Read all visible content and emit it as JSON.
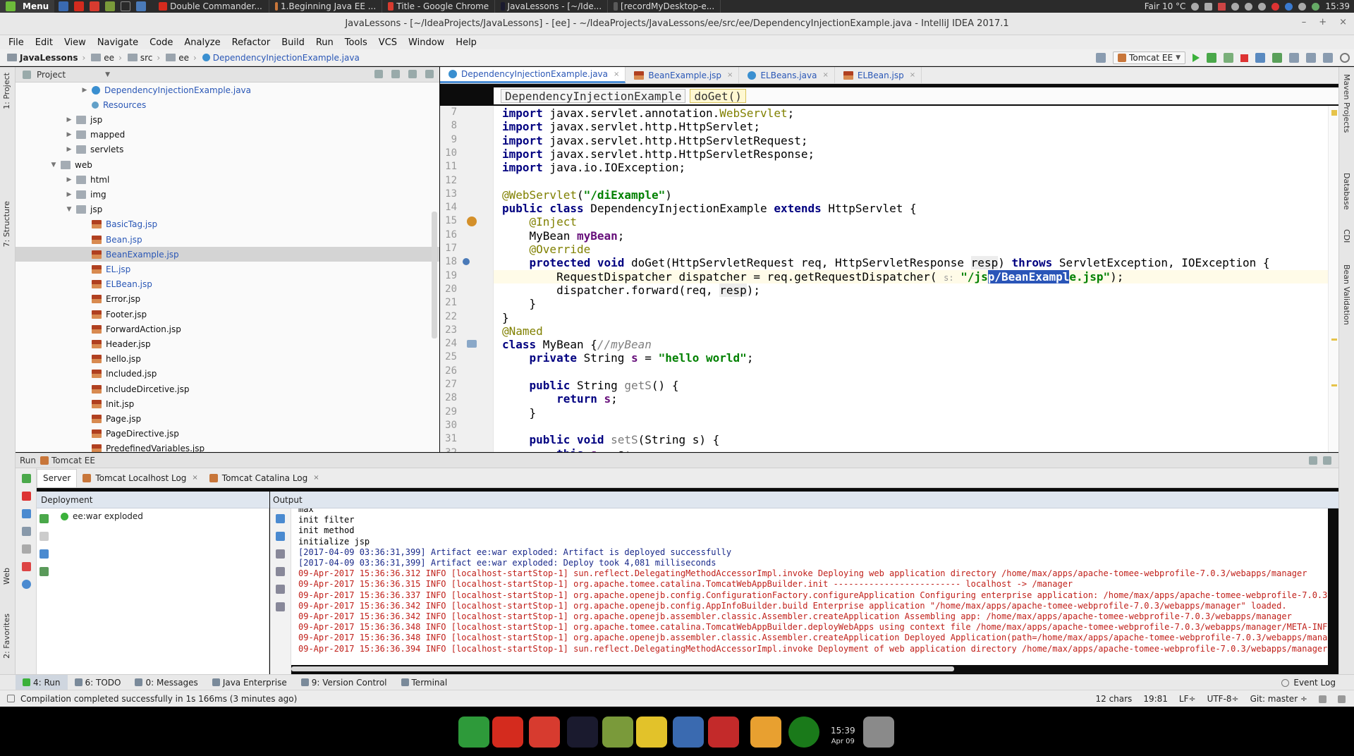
{
  "os_panel": {
    "menu_label": "Menu",
    "tasks": [
      "Double Commander...",
      "1.Beginning Java EE ...",
      "Title - Google Chrome",
      "JavaLessons - [~/Ide...",
      "[recordMyDesktop-e..."
    ],
    "weather": "Fair 10 °C",
    "clock": "15:39"
  },
  "window": {
    "title": "JavaLessons - [~/IdeaProjects/JavaLessons] - [ee] - ~/IdeaProjects/JavaLessons/ee/src/ee/DependencyInjectionExample.java - IntelliJ IDEA 2017.1"
  },
  "menubar": [
    "File",
    "Edit",
    "View",
    "Navigate",
    "Code",
    "Analyze",
    "Refactor",
    "Build",
    "Run",
    "Tools",
    "VCS",
    "Window",
    "Help"
  ],
  "navbar": {
    "crumbs": [
      "JavaLessons",
      "ee",
      "src",
      "ee",
      "DependencyInjectionExample.java"
    ],
    "run_config": "Tomcat EE"
  },
  "left_stripe": [
    "1: Project",
    "7: Structure",
    "Web",
    "2: Favorites"
  ],
  "right_stripe": [
    "Maven Projects",
    "Database",
    "CDI",
    "Bean Validation"
  ],
  "project": {
    "header": "Project",
    "tree": [
      {
        "label": "DependencyInjectionExample.java",
        "type": "java",
        "indent": 3,
        "arrow": "▶",
        "blue": true
      },
      {
        "label": "Resources",
        "type": "res",
        "indent": 3,
        "arrow": "",
        "blue": true
      },
      {
        "label": "jsp",
        "type": "folder",
        "indent": 2,
        "arrow": "▶",
        "blue": false
      },
      {
        "label": "mapped",
        "type": "folder",
        "indent": 2,
        "arrow": "▶",
        "blue": false
      },
      {
        "label": "servlets",
        "type": "folder",
        "indent": 2,
        "arrow": "▶",
        "blue": false
      },
      {
        "label": "web",
        "type": "folder",
        "indent": 1,
        "arrow": "▼",
        "blue": false
      },
      {
        "label": "html",
        "type": "folder",
        "indent": 2,
        "arrow": "▶",
        "blue": false
      },
      {
        "label": "img",
        "type": "folder",
        "indent": 2,
        "arrow": "▶",
        "blue": false
      },
      {
        "label": "jsp",
        "type": "folder",
        "indent": 2,
        "arrow": "▼",
        "blue": false
      },
      {
        "label": "BasicTag.jsp",
        "type": "jsp",
        "indent": 3,
        "arrow": "",
        "blue": true
      },
      {
        "label": "Bean.jsp",
        "type": "jsp",
        "indent": 3,
        "arrow": "",
        "blue": true
      },
      {
        "label": "BeanExample.jsp",
        "type": "jsp",
        "indent": 3,
        "arrow": "",
        "blue": true,
        "selected": true
      },
      {
        "label": "EL.jsp",
        "type": "jsp",
        "indent": 3,
        "arrow": "",
        "blue": true
      },
      {
        "label": "ELBean.jsp",
        "type": "jsp",
        "indent": 3,
        "arrow": "",
        "blue": true
      },
      {
        "label": "Error.jsp",
        "type": "jsp",
        "indent": 3,
        "arrow": "",
        "blue": false
      },
      {
        "label": "Footer.jsp",
        "type": "jsp",
        "indent": 3,
        "arrow": "",
        "blue": false
      },
      {
        "label": "ForwardAction.jsp",
        "type": "jsp",
        "indent": 3,
        "arrow": "",
        "blue": false
      },
      {
        "label": "Header.jsp",
        "type": "jsp",
        "indent": 3,
        "arrow": "",
        "blue": false
      },
      {
        "label": "hello.jsp",
        "type": "jsp",
        "indent": 3,
        "arrow": "",
        "blue": false
      },
      {
        "label": "Included.jsp",
        "type": "jsp",
        "indent": 3,
        "arrow": "",
        "blue": false
      },
      {
        "label": "IncludeDircetive.jsp",
        "type": "jsp",
        "indent": 3,
        "arrow": "",
        "blue": false
      },
      {
        "label": "Init.jsp",
        "type": "jsp",
        "indent": 3,
        "arrow": "",
        "blue": false
      },
      {
        "label": "Page.jsp",
        "type": "jsp",
        "indent": 3,
        "arrow": "",
        "blue": false
      },
      {
        "label": "PageDirective.jsp",
        "type": "jsp",
        "indent": 3,
        "arrow": "",
        "blue": false
      },
      {
        "label": "PredefinedVariables.jsp",
        "type": "jsp",
        "indent": 3,
        "arrow": "",
        "blue": false
      }
    ]
  },
  "editor": {
    "tabs": [
      {
        "label": "DependencyInjectionExample.java",
        "active": true,
        "icon": "java-class-icon"
      },
      {
        "label": "BeanExample.jsp",
        "active": false,
        "icon": "jsp-file-icon"
      },
      {
        "label": "ELBeans.java",
        "active": false,
        "icon": "java-class-icon"
      },
      {
        "label": "ELBean.jsp",
        "active": false,
        "icon": "jsp-file-icon"
      }
    ],
    "breadcrumb_class": "DependencyInjectionExample",
    "breadcrumb_method": "doGet()",
    "param_hint": "s:",
    "lines": [
      {
        "n": "7",
        "html": "<span class='kw'>import</span> javax.servlet.annotation.<span class='an'>WebServlet</span>;"
      },
      {
        "n": "8",
        "html": "<span class='kw'>import</span> javax.servlet.http.HttpServlet;"
      },
      {
        "n": "9",
        "html": "<span class='kw'>import</span> javax.servlet.http.HttpServletRequest;"
      },
      {
        "n": "10",
        "html": "<span class='kw'>import</span> javax.servlet.http.HttpServletResponse;"
      },
      {
        "n": "11",
        "html": "<span class='kw'>import</span> java.io.IOException;"
      },
      {
        "n": "12",
        "html": ""
      },
      {
        "n": "13",
        "html": "<span class='an'>@WebServlet</span>(<span class='st'>\"/diExample\"</span>)"
      },
      {
        "n": "14",
        "html": "<span class='kw'>public class</span> DependencyInjectionExample <span class='kw'>extends</span> HttpServlet {"
      },
      {
        "n": "15",
        "html": "    <span class='an'>@Inject</span>"
      },
      {
        "n": "16",
        "html": "    MyBean <span class='fld'>myBean</span>;"
      },
      {
        "n": "17",
        "html": "    <span class='an'>@Override</span>"
      },
      {
        "n": "18",
        "html": "    <span class='kw'>protected void</span> doGet(HttpServletRequest req, HttpServletResponse <span class='param'>resp</span>) <span class='kw'>throws</span> ServletException, IOException {"
      },
      {
        "n": "19",
        "html": "        RequestDispatcher dispatcher = req.getRequestDispatcher( <span class='hint'>s:</span> <span class='st'>\"/js<span class='sel2'>p/BeanExampl</span>e.jsp\"</span>);"
      },
      {
        "n": "20",
        "html": "        dispatcher.forward(req, <span class='param'>resp</span>);"
      },
      {
        "n": "21",
        "html": "    }"
      },
      {
        "n": "22",
        "html": "}"
      },
      {
        "n": "23",
        "html": "<span class='an'>@Named</span>"
      },
      {
        "n": "24",
        "html": "<span class='kw'>class</span> MyBean {<span class='cm'>//myBean</span>"
      },
      {
        "n": "25",
        "html": "    <span class='kw'>private</span> String <span class='fld'>s</span> = <span class='st'>\"hello world\"</span>;"
      },
      {
        "n": "26",
        "html": ""
      },
      {
        "n": "27",
        "html": "    <span class='kw'>public</span> String <span class='mt'>getS</span>() {"
      },
      {
        "n": "28",
        "html": "        <span class='kw'>return</span> <span class='fld'>s</span>;"
      },
      {
        "n": "29",
        "html": "    }"
      },
      {
        "n": "30",
        "html": ""
      },
      {
        "n": "31",
        "html": "    <span class='kw'>public void</span> <span class='mt'>setS</span>(String s) {"
      },
      {
        "n": "32",
        "html": "        <span class='kw'>this</span>.<span class='fld'>s</span> = s;"
      }
    ]
  },
  "run": {
    "header": "Run",
    "config": "Tomcat EE",
    "tabs": [
      {
        "label": "Server",
        "active": true,
        "close": false
      },
      {
        "label": "Tomcat Localhost Log",
        "active": false,
        "close": true
      },
      {
        "label": "Tomcat Catalina Log",
        "active": false,
        "close": true
      }
    ],
    "deployment_header": "Deployment",
    "deployment_item": "ee:war exploded",
    "output_header": "Output",
    "output_lines": [
      {
        "text": "max",
        "kind": "sys"
      },
      {
        "text": "init filter",
        "kind": "sys"
      },
      {
        "text": "init method",
        "kind": "sys"
      },
      {
        "text": "initialize jsp",
        "kind": "sys"
      },
      {
        "text": "[2017-04-09 03:36:31,399] Artifact ee:war exploded: Artifact is deployed successfully",
        "kind": "art"
      },
      {
        "text": "[2017-04-09 03:36:31,399] Artifact ee:war exploded: Deploy took 4,081 milliseconds",
        "kind": "art"
      },
      {
        "text": "09-Apr-2017 15:36:36.312 INFO [localhost-startStop-1] sun.reflect.DelegatingMethodAccessorImpl.invoke Deploying web application directory /home/max/apps/apache-tomee-webprofile-7.0.3/webapps/manager",
        "kind": "err"
      },
      {
        "text": "09-Apr-2017 15:36:36.315 INFO [localhost-startStop-1] org.apache.tomee.catalina.TomcatWebAppBuilder.init ------------------------- localhost -> /manager",
        "kind": "err"
      },
      {
        "text": "09-Apr-2017 15:36:36.337 INFO [localhost-startStop-1] org.apache.openejb.config.ConfigurationFactory.configureApplication Configuring enterprise application: /home/max/apps/apache-tomee-webprofile-7.0.3/webapps/",
        "kind": "err"
      },
      {
        "text": "09-Apr-2017 15:36:36.342 INFO [localhost-startStop-1] org.apache.openejb.config.AppInfoBuilder.build Enterprise application \"/home/max/apps/apache-tomee-webprofile-7.0.3/webapps/manager\" loaded.",
        "kind": "err"
      },
      {
        "text": "09-Apr-2017 15:36:36.342 INFO [localhost-startStop-1] org.apache.openejb.assembler.classic.Assembler.createApplication Assembling app: /home/max/apps/apache-tomee-webprofile-7.0.3/webapps/manager",
        "kind": "err"
      },
      {
        "text": "09-Apr-2017 15:36:36.348 INFO [localhost-startStop-1] org.apache.tomee.catalina.TomcatWebAppBuilder.deployWebApps using context file /home/max/apps/apache-tomee-webprofile-7.0.3/webapps/manager/META-INF/context.",
        "kind": "err"
      },
      {
        "text": "09-Apr-2017 15:36:36.348 INFO [localhost-startStop-1] org.apache.openejb.assembler.classic.Assembler.createApplication Deployed Application(path=/home/max/apps/apache-tomee-webprofile-7.0.3/webapps/manager)",
        "kind": "err"
      },
      {
        "text": "09-Apr-2017 15:36:36.394 INFO [localhost-startStop-1] sun.reflect.DelegatingMethodAccessorImpl.invoke Deployment of web application directory /home/max/apps/apache-tomee-webprofile-7.0.3/webapps/manager has fini",
        "kind": "err"
      }
    ]
  },
  "bottom_tools": [
    {
      "label": "4: Run",
      "active": true
    },
    {
      "label": "6: TODO",
      "active": false
    },
    {
      "label": "0: Messages",
      "active": false
    },
    {
      "label": "Java Enterprise",
      "active": false
    },
    {
      "label": "9: Version Control",
      "active": false
    },
    {
      "label": "Terminal",
      "active": false
    }
  ],
  "event_log": "Event Log",
  "status": {
    "message": "Compilation completed successfully in 1s 166ms (3 minutes ago)",
    "chars": "12 chars",
    "position": "19:81",
    "line_sep": "LF÷",
    "encoding": "UTF-8÷",
    "git": "Git: master ÷"
  },
  "dock": {
    "time": "15:39",
    "date": "Apr 09",
    "icons": [
      "anchor-icon",
      "double-commander-icon",
      "chrome-icon",
      "intellij-icon",
      "spiral-icon",
      "puzzle-icon",
      "media-player-icon",
      "pdf-icon",
      "weather-icon",
      "network-icon",
      "trash-icon"
    ],
    "colors": [
      "#2e9a3a",
      "#d42b1e",
      "#d73b2f",
      "#1a1a2e",
      "#7a9a3a",
      "#e2c22a",
      "#3a6ab0",
      "#c32a2a",
      "#e8a030",
      "#1a7a1a",
      "#8a8a8a"
    ]
  },
  "colors": {
    "accent": "#4d8fd6",
    "selection": "#2a55b8",
    "run_green": "#3bb13b",
    "stop_red": "#dd3333"
  }
}
